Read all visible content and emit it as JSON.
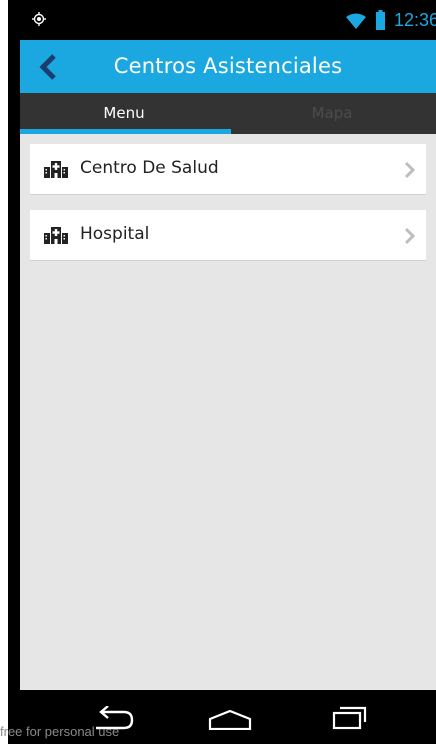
{
  "status_bar": {
    "time": "12:36",
    "icons": [
      "location-icon",
      "wifi-icon",
      "battery-icon"
    ]
  },
  "app_bar": {
    "title": "Centros Asistenciales",
    "back_icon": "chevron-left-icon"
  },
  "tabs": [
    {
      "label": "Menu",
      "selected": true
    },
    {
      "label": "Mapa",
      "selected": false
    }
  ],
  "list": {
    "items": [
      {
        "label": "Centro De Salud",
        "icon": "hospital-icon"
      },
      {
        "label": "Hospital",
        "icon": "hospital-icon"
      }
    ]
  },
  "nav_bar": {
    "icons": [
      "back-nav-icon",
      "home-nav-icon",
      "recents-nav-icon"
    ]
  },
  "watermark": "free for personal use",
  "colors": {
    "accent": "#1ba8e0",
    "tab_bar": "#333333",
    "background": "#e6e6e6"
  }
}
